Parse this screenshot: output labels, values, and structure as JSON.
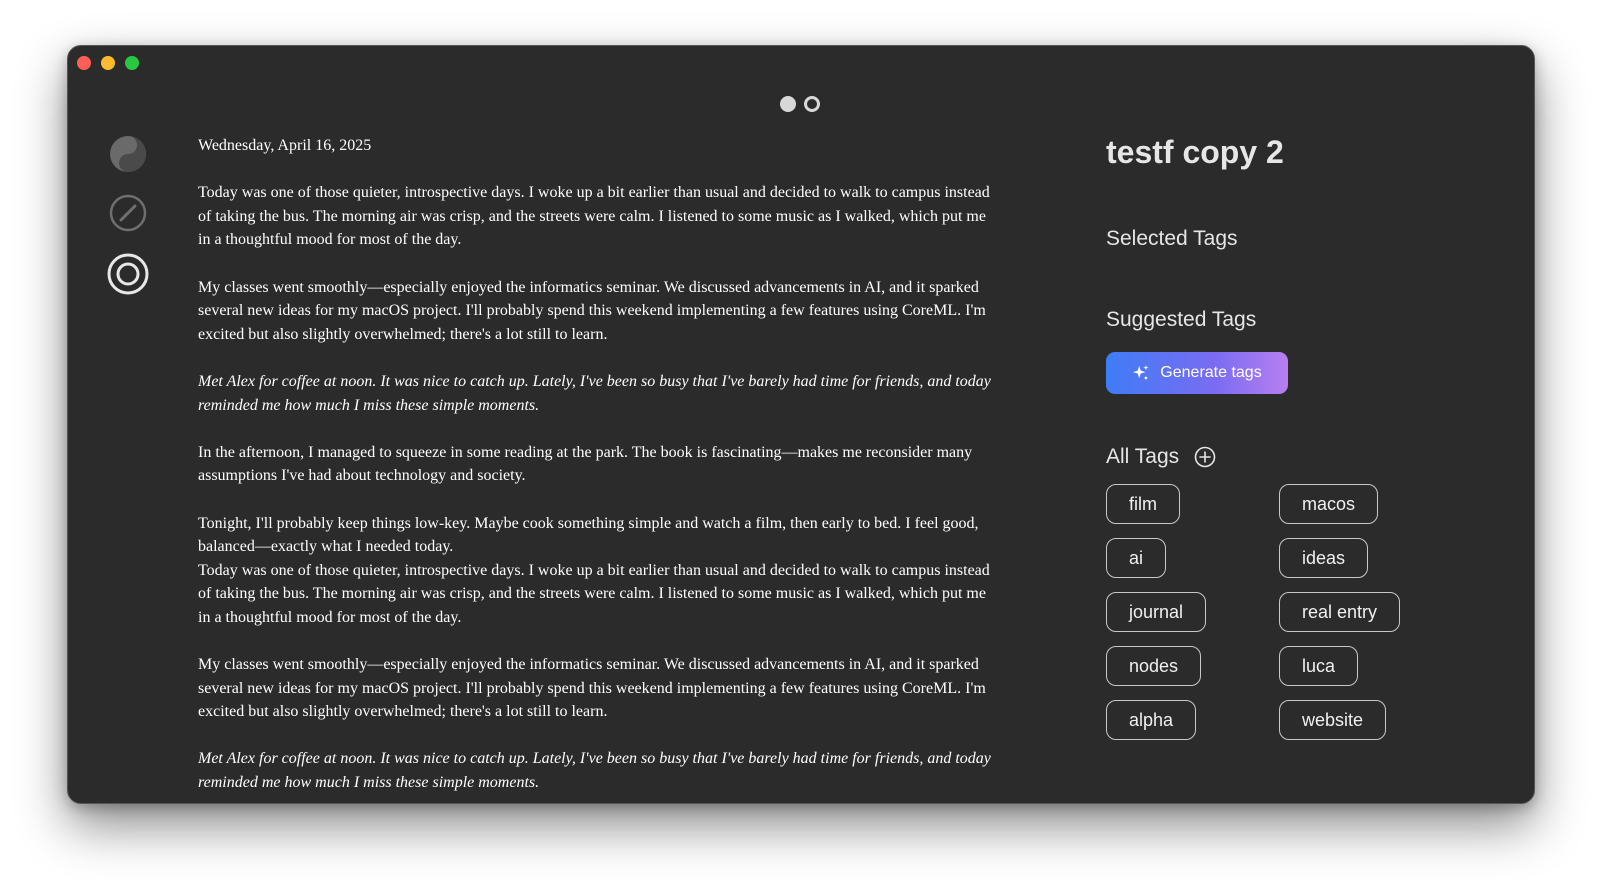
{
  "window": {
    "controls": [
      "close",
      "minimize",
      "zoom"
    ]
  },
  "pager": {
    "total": 2,
    "current": 1
  },
  "sidebar": {
    "items": [
      {
        "icon": "yin-yang-icon"
      },
      {
        "icon": "pencil-circle-icon"
      },
      {
        "icon": "target-ring-icon",
        "active": true
      }
    ]
  },
  "editor": {
    "date": "Wednesday, April 16, 2025",
    "paragraphs": [
      "Today was one of those quieter, introspective days. I woke up a bit earlier than usual and decided to walk to campus instead of taking the bus. The morning air was crisp, and the streets were calm. I listened to some music as I walked, which put me in a thoughtful mood for most of the day.",
      "My classes went smoothly—especially enjoyed the informatics seminar. We discussed advancements in AI, and it sparked several new ideas for my macOS project. I'll probably spend this weekend implementing a few features using CoreML. I'm excited but also slightly overwhelmed; there's a lot still to learn.",
      "Met Alex for coffee at noon. It was nice to catch up. Lately, I've been so busy that I've barely had time for friends, and today reminded me how much I miss these simple moments.",
      "In the afternoon, I managed to squeeze in some reading at the park. The book is fascinating—makes me reconsider many assumptions I've had about technology and society.",
      "Tonight, I'll probably keep things low-key. Maybe cook something simple and watch a film, then early to bed. I feel good, balanced—exactly what I needed today.",
      "Today was one of those quieter, introspective days. I woke up a bit earlier than usual and decided to walk to campus instead of taking the bus. The morning air was crisp, and the streets were calm. I listened to some music as I walked, which put me in a thoughtful mood for most of the day.",
      "My classes went smoothly—especially enjoyed the informatics seminar. We discussed advancements in AI, and it sparked several new ideas for my macOS project. I'll probably spend this weekend implementing a few features using CoreML. I'm excited but also slightly overwhelmed; there's a lot still to learn.",
      "Met Alex for coffee at noon. It was nice to catch up. Lately, I've been so busy that I've barely had time for friends, and today reminded me how much I miss these simple moments."
    ]
  },
  "panel": {
    "title": "testf copy 2",
    "selected_tags_heading": "Selected Tags",
    "suggested_tags_heading": "Suggested Tags",
    "generate_button_label": "Generate tags",
    "generate_icon": "sparkle-icon",
    "all_tags_heading": "All Tags",
    "add_tag_icon": "plus-circle-icon",
    "tags": [
      "film",
      "macos",
      "ai",
      "ideas",
      "journal",
      "real entry",
      "nodes",
      "luca",
      "alpha",
      "website"
    ]
  },
  "colors": {
    "window_bg": "#2b2b2b",
    "text": "#ffffff",
    "heading": "#e6e6e6",
    "button_gradient_start": "#3f7cf6",
    "button_gradient_end": "#b77ff0",
    "chip_border": "#c8c8c8"
  }
}
